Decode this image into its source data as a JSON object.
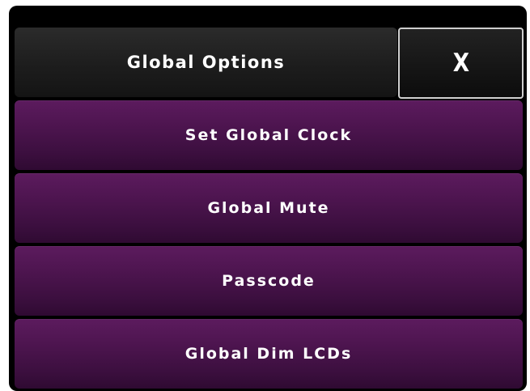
{
  "header": {
    "title": "Global Options",
    "close_label": "X"
  },
  "menu": {
    "items": [
      {
        "label": "Set Global Clock"
      },
      {
        "label": "Global Mute"
      },
      {
        "label": "Passcode"
      },
      {
        "label": "Global Dim LCDs"
      }
    ]
  },
  "colors": {
    "background": "#000000",
    "header": "#1d1d1d",
    "button": "#4a144c",
    "text": "#ffffff"
  }
}
